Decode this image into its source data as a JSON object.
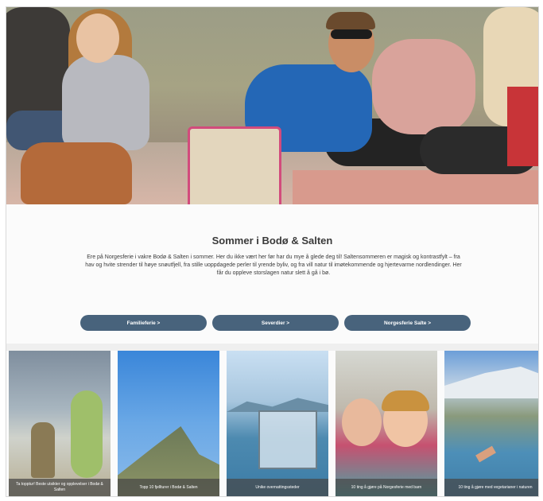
{
  "section": {
    "title": "Sommer i Bodø & Salten",
    "description": "Ere på Norgesferie i vakre Bodø & Salten i sommer. Her du ikke vært her før har du mye å glede deg til! Saltensommeren er magisk og kontrastfylt – fra hav og hvite strender til høye snøutfjell, fra stille uoppdagede perler til yrende byliv, og fra vill natur til imøtekommende og hjertevarme nordlendinger. Her får du oppleve storslagen natur slett å gå i bø."
  },
  "buttons": [
    {
      "label": "Familieferie >"
    },
    {
      "label": "Severdier >"
    },
    {
      "label": "Norgesferie Salte >"
    }
  ],
  "cards": [
    {
      "caption": "Ta topptur! Beste utsikter og opplevelser i Bodø & Salten"
    },
    {
      "caption": "Topp 10 fjellturer i Bodø & Salten"
    },
    {
      "caption": "Unike overnattingssteder"
    },
    {
      "caption": "10 ting å gjøre på Norgesferie med barn"
    },
    {
      "caption": "10 ting å gjøre med vegetarianer i naturen"
    }
  ],
  "colors": {
    "button_bg": "#48637c",
    "button_text": "#ffffff",
    "title": "#3a3a3a"
  }
}
